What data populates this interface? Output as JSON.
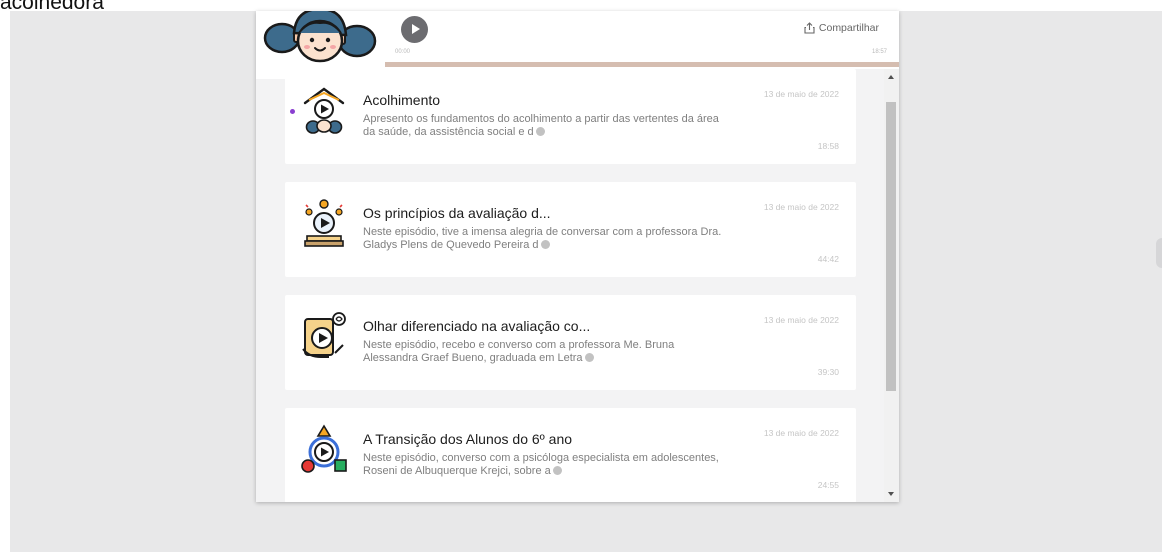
{
  "page": {
    "top_text": "acolhedora"
  },
  "player": {
    "time_start": "00:00",
    "time_end": "18:57",
    "progress": 0,
    "share_label": "Compartilhar"
  },
  "episodes": [
    {
      "title": "Acolhimento",
      "description": "Apresento os fundamentos do acolhimento a partir das vertentes da área da saúde, da assistência social e d",
      "date": "13 de maio de 2022",
      "duration": "18:58",
      "icon": "house-care-play-icon",
      "playing": true
    },
    {
      "title": "Os princípios da avaliação d...",
      "description": "Neste episódio, tive a imensa alegria de conversar com a professora Dra. Gladys Plens de Quevedo Pereira d",
      "date": "13 de maio de 2022",
      "duration": "44:42",
      "icon": "lightbulb-book-play-icon",
      "playing": false
    },
    {
      "title": "Olhar diferenciado na avaliação co...",
      "description": "Neste episódio, recebo e converso com a professora Me. Bruna Alessandra Graef Bueno, graduada em Letra",
      "date": "13 de maio de 2022",
      "duration": "39:30",
      "icon": "tablet-hand-play-icon",
      "playing": false
    },
    {
      "title": "A Transição dos Alunos do 6º ano",
      "description": "Neste episódio, converso com a psicóloga especialista em adolescentes, Roseni de Albuquerque Krejci, sobre a",
      "date": "13 de maio de 2022",
      "duration": "24:55",
      "icon": "shapes-cycle-play-icon",
      "playing": false
    }
  ],
  "colors": {
    "accent_purple": "#8a3fd0",
    "progress_track": "#d5bdb0",
    "orange": "#f5a623",
    "green": "#27ae60",
    "red": "#e53935",
    "blue": "#3b6fd8"
  }
}
